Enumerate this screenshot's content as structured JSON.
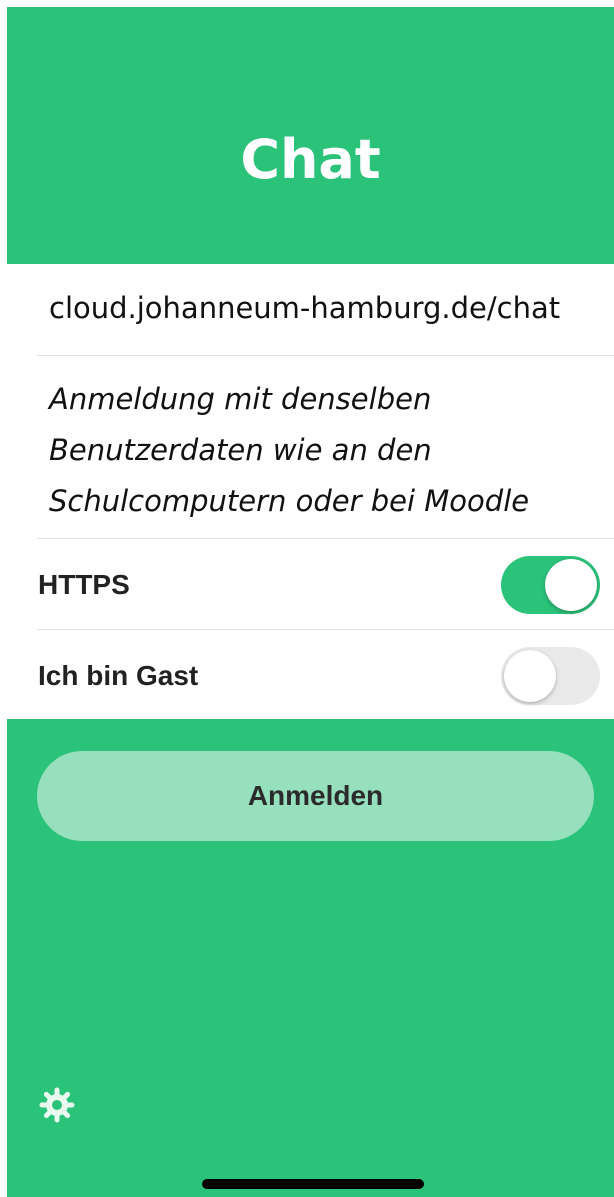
{
  "header": {
    "title": "Chat"
  },
  "form": {
    "server_url": "cloud.johanneum-hamburg.de/chat",
    "hint": "Anmeldung mit denselben Benutzerdaten wie an den Schulcomputern oder bei Moodle",
    "toggles": [
      {
        "label": "HTTPS",
        "state": "on"
      },
      {
        "label": "Ich bin Gast",
        "state": "off"
      }
    ]
  },
  "actions": {
    "login_label": "Anmelden"
  },
  "icons": {
    "settings": "gear-icon"
  },
  "colors": {
    "accent": "#2bc27a",
    "button_background": "#96e0bd",
    "switch_off": "#e9e9ea"
  }
}
